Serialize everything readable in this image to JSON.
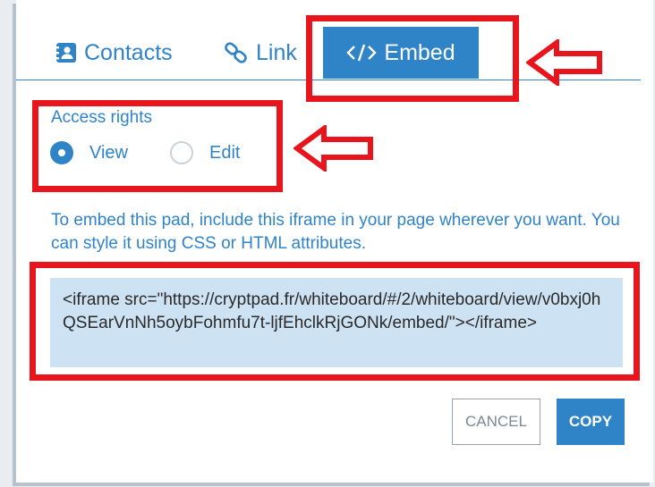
{
  "tabs": {
    "contacts": "Contacts",
    "link": "Link",
    "embed": "Embed",
    "active": "embed"
  },
  "access": {
    "title": "Access rights",
    "view": "View",
    "edit": "Edit",
    "selected": "view"
  },
  "instructions": "To embed this pad, include this iframe in your page wherever you want. You can style it using CSS or HTML attributes.",
  "embed_code": "<iframe src=\"https://cryptpad.fr/whiteboard/#/2/whiteboard/view/v0bxj0hQSEarVnNh5oybFohmfu7t-ljfEhclkRjGONk/embed/\"></iframe>",
  "buttons": {
    "cancel": "CANCEL",
    "copy": "COPY"
  },
  "colors": {
    "accent": "#2f83c7",
    "code_background": "#cde2f2",
    "annotation": "#e8161c"
  },
  "icons": {
    "contacts": "address-book-icon",
    "link": "link-icon",
    "embed": "code-icon"
  }
}
